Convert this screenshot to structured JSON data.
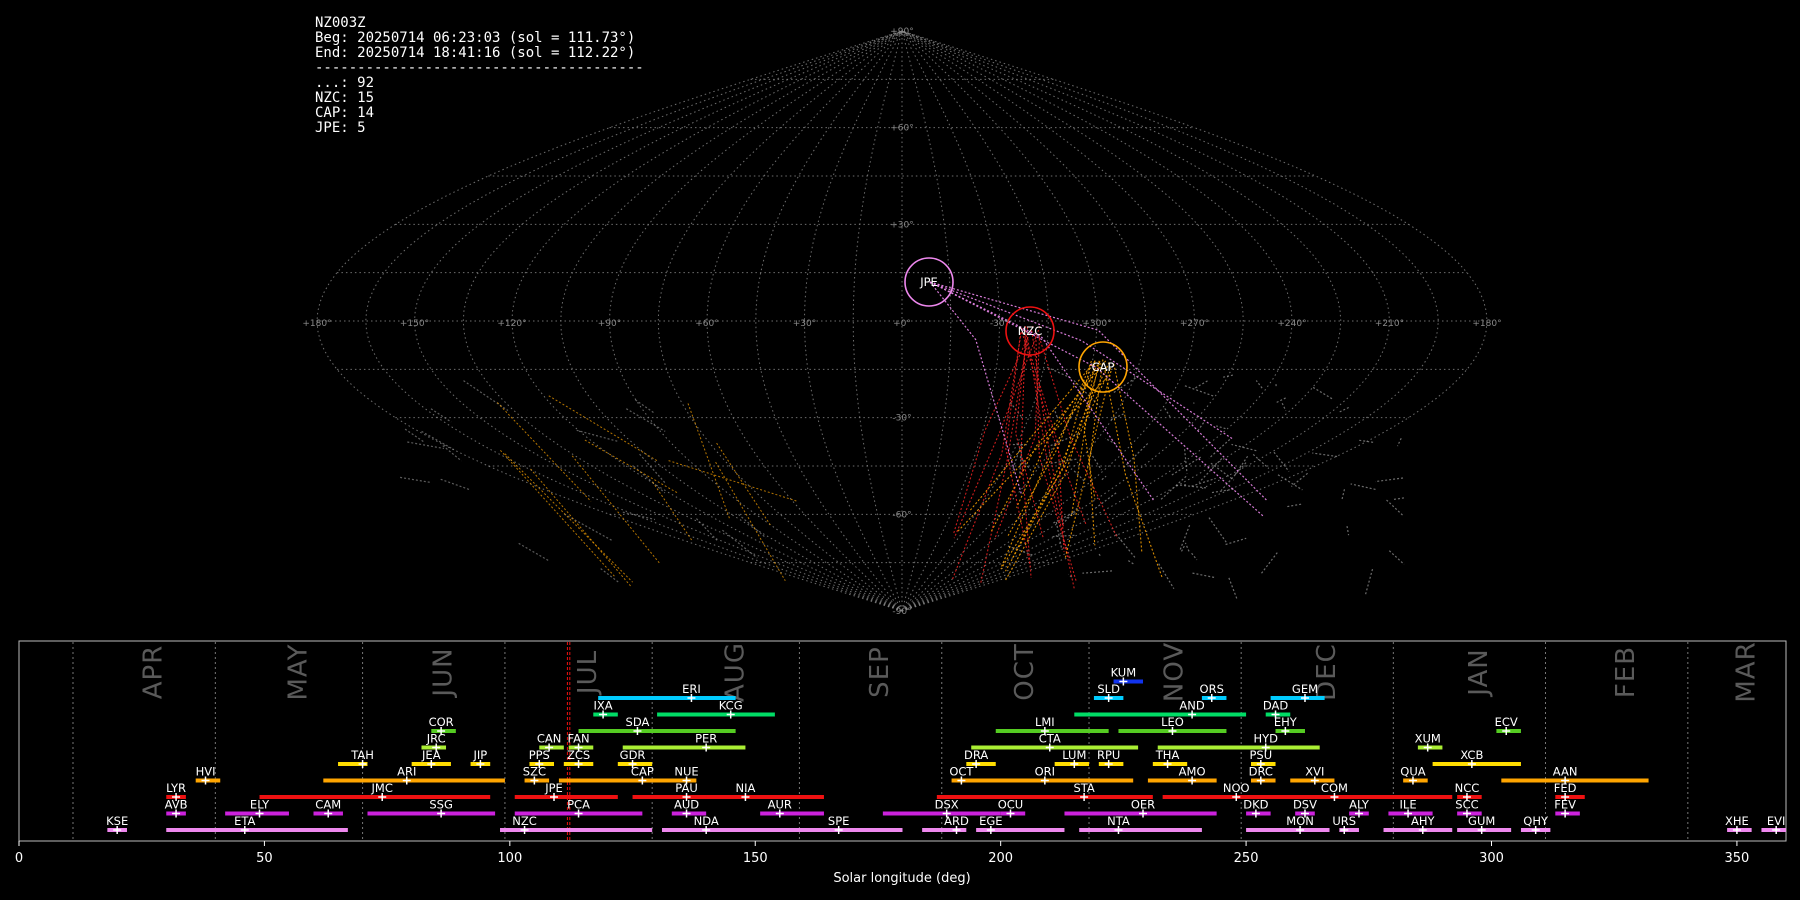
{
  "header": {
    "station": "NZ003Z",
    "begin": "Beg: 20250714 06:23:03 (sol = 111.73°)",
    "end": "End: 20250714 18:41:16 (sol = 112.22°)",
    "separator": "---------------------------------------",
    "counts": [
      "...: 92",
      "NZC: 15",
      "CAP: 14",
      "JPE: 5"
    ]
  },
  "sky_map": {
    "projection": "sinusoidal",
    "lon_ticks": [
      "+180°",
      "+150°",
      "+120°",
      "+90°",
      "+60°",
      "+30°",
      "+0°",
      "-30°",
      "+300°",
      "+270°",
      "+240°",
      "+210°",
      "+180°"
    ],
    "lat_ticks": [
      "+90°",
      "+60°",
      "+30°",
      "-30°",
      "-60°",
      "-90°"
    ],
    "radiants": [
      {
        "name": "JPE",
        "color": "#ee88ee"
      },
      {
        "name": "NZC",
        "color": "#ee1111"
      },
      {
        "name": "CAP",
        "color": "#ffa500"
      }
    ]
  },
  "chart_data": {
    "type": "timeline",
    "xlabel": "Solar longitude (deg)",
    "xlim": [
      0,
      360
    ],
    "xticks": [
      0,
      50,
      100,
      150,
      200,
      250,
      300,
      350
    ],
    "months": [
      {
        "name": "APR",
        "start": 11,
        "end": 40
      },
      {
        "name": "MAY",
        "start": 40,
        "end": 70
      },
      {
        "name": "JUN",
        "start": 70,
        "end": 99
      },
      {
        "name": "JUL",
        "start": 99,
        "end": 129
      },
      {
        "name": "AUG",
        "start": 129,
        "end": 159
      },
      {
        "name": "SEP",
        "start": 159,
        "end": 188
      },
      {
        "name": "OCT",
        "start": 188,
        "end": 218
      },
      {
        "name": "NOV",
        "start": 218,
        "end": 249
      },
      {
        "name": "DEC",
        "start": 249,
        "end": 280
      },
      {
        "name": "JAN",
        "start": 280,
        "end": 311
      },
      {
        "name": "FEB",
        "start": 311,
        "end": 340
      },
      {
        "name": "MAR",
        "start": 340,
        "end": 370
      }
    ],
    "current_sol": [
      111.73,
      112.22
    ],
    "showers": [
      {
        "code": "KUM",
        "start": 223,
        "end": 229,
        "peak": 225,
        "row": 9,
        "color": "#1133ee"
      },
      {
        "code": "ERI",
        "start": 118,
        "end": 146,
        "peak": 137,
        "row": 8,
        "color": "#00ccff"
      },
      {
        "code": "SLD",
        "start": 219,
        "end": 225,
        "peak": 222,
        "row": 8,
        "color": "#00ccff"
      },
      {
        "code": "ORS",
        "start": 241,
        "end": 246,
        "peak": 243,
        "row": 8,
        "color": "#00ccff"
      },
      {
        "code": "GEM",
        "start": 255,
        "end": 266,
        "peak": 262,
        "row": 8,
        "color": "#00ccff"
      },
      {
        "code": "IXA",
        "start": 117,
        "end": 122,
        "peak": 119,
        "row": 7,
        "color": "#00dd66"
      },
      {
        "code": "KCG",
        "start": 130,
        "end": 154,
        "peak": 145,
        "row": 7,
        "color": "#00dd66"
      },
      {
        "code": "AND",
        "start": 215,
        "end": 250,
        "peak": 239,
        "row": 7,
        "color": "#00dd66"
      },
      {
        "code": "DAD",
        "start": 254,
        "end": 259,
        "peak": 256,
        "row": 7,
        "color": "#00dd66"
      },
      {
        "code": "COR",
        "start": 84,
        "end": 89,
        "peak": 86,
        "row": 6,
        "color": "#55cc22"
      },
      {
        "code": "SDA",
        "start": 114,
        "end": 146,
        "peak": 126,
        "row": 6,
        "color": "#55cc22"
      },
      {
        "code": "LMI",
        "start": 199,
        "end": 222,
        "peak": 209,
        "row": 6,
        "color": "#55cc22"
      },
      {
        "code": "LEO",
        "start": 224,
        "end": 246,
        "peak": 235,
        "row": 6,
        "color": "#55cc22"
      },
      {
        "code": "EHY",
        "start": 256,
        "end": 262,
        "peak": 258,
        "row": 6,
        "color": "#55cc22"
      },
      {
        "code": "ECV",
        "start": 301,
        "end": 306,
        "peak": 303,
        "row": 6,
        "color": "#55cc22"
      },
      {
        "code": "JRC",
        "start": 82,
        "end": 87,
        "peak": 85,
        "row": 5,
        "color": "#aaee33"
      },
      {
        "code": "CAN",
        "start": 106,
        "end": 111,
        "peak": 108,
        "row": 5,
        "color": "#aaee33"
      },
      {
        "code": "FAN",
        "start": 112,
        "end": 117,
        "peak": 114,
        "row": 5,
        "color": "#aaee33"
      },
      {
        "code": "PER",
        "start": 123,
        "end": 148,
        "peak": 140,
        "row": 5,
        "color": "#aaee33"
      },
      {
        "code": "CTA",
        "start": 194,
        "end": 228,
        "peak": 210,
        "row": 5,
        "color": "#aaee33"
      },
      {
        "code": "HYD",
        "start": 232,
        "end": 265,
        "peak": 254,
        "row": 5,
        "color": "#aaee33"
      },
      {
        "code": "XUM",
        "start": 285,
        "end": 290,
        "peak": 287,
        "row": 5,
        "color": "#aaee33"
      },
      {
        "code": "TAH",
        "start": 65,
        "end": 71,
        "peak": 70,
        "row": 4,
        "color": "#ffdd00"
      },
      {
        "code": "JEA",
        "start": 80,
        "end": 88,
        "peak": 84,
        "row": 4,
        "color": "#ffdd00"
      },
      {
        "code": "JIP",
        "start": 92,
        "end": 96,
        "peak": 94,
        "row": 4,
        "color": "#ffdd00"
      },
      {
        "code": "PPS",
        "start": 104,
        "end": 109,
        "peak": 106,
        "row": 4,
        "color": "#ffdd00"
      },
      {
        "code": "ZCS",
        "start": 111,
        "end": 117,
        "peak": 114,
        "row": 4,
        "color": "#ffdd00"
      },
      {
        "code": "GDR",
        "start": 122,
        "end": 129,
        "peak": 125,
        "row": 4,
        "color": "#ffdd00"
      },
      {
        "code": "DRA",
        "start": 193,
        "end": 199,
        "peak": 195,
        "row": 4,
        "color": "#ffdd00"
      },
      {
        "code": "LUM",
        "start": 211,
        "end": 218,
        "peak": 215,
        "row": 4,
        "color": "#ffdd00"
      },
      {
        "code": "RPU",
        "start": 220,
        "end": 225,
        "peak": 222,
        "row": 4,
        "color": "#ffdd00"
      },
      {
        "code": "THA",
        "start": 231,
        "end": 238,
        "peak": 234,
        "row": 4,
        "color": "#ffdd00"
      },
      {
        "code": "PSU",
        "start": 251,
        "end": 256,
        "peak": 253,
        "row": 4,
        "color": "#ffdd00"
      },
      {
        "code": "XCB",
        "start": 288,
        "end": 306,
        "peak": 296,
        "row": 4,
        "color": "#ffdd00"
      },
      {
        "code": "HVI",
        "start": 36,
        "end": 41,
        "peak": 38,
        "row": 3,
        "color": "#ffa500"
      },
      {
        "code": "ARI",
        "start": 62,
        "end": 99,
        "peak": 79,
        "row": 3,
        "color": "#ffa500"
      },
      {
        "code": "SZC",
        "start": 103,
        "end": 108,
        "peak": 105,
        "row": 3,
        "color": "#ffa500"
      },
      {
        "code": "CAP",
        "start": 110,
        "end": 136,
        "peak": 127,
        "row": 3,
        "color": "#ffa500"
      },
      {
        "code": "NUE",
        "start": 134,
        "end": 138,
        "peak": 136,
        "row": 3,
        "color": "#ffa500"
      },
      {
        "code": "OCT",
        "start": 190,
        "end": 195,
        "peak": 192,
        "row": 3,
        "color": "#ffa500"
      },
      {
        "code": "ORI",
        "start": 193,
        "end": 227,
        "peak": 209,
        "row": 3,
        "color": "#ffa500"
      },
      {
        "code": "AMO",
        "start": 230,
        "end": 244,
        "peak": 239,
        "row": 3,
        "color": "#ffa500"
      },
      {
        "code": "DRC",
        "start": 251,
        "end": 256,
        "peak": 253,
        "row": 3,
        "color": "#ffa500"
      },
      {
        "code": "XVI",
        "start": 259,
        "end": 268,
        "peak": 264,
        "row": 3,
        "color": "#ffa500"
      },
      {
        "code": "QUA",
        "start": 282,
        "end": 287,
        "peak": 284,
        "row": 3,
        "color": "#ffa500"
      },
      {
        "code": "AAN",
        "start": 302,
        "end": 332,
        "peak": 315,
        "row": 3,
        "color": "#ffa500"
      },
      {
        "code": "LYR",
        "start": 30,
        "end": 34,
        "peak": 32,
        "row": 2,
        "color": "#ee1111"
      },
      {
        "code": "JMC",
        "start": 49,
        "end": 96,
        "peak": 74,
        "row": 2,
        "color": "#ee1111"
      },
      {
        "code": "JPE",
        "start": 101,
        "end": 122,
        "peak": 109,
        "row": 2,
        "color": "#ee1111"
      },
      {
        "code": "PAU",
        "start": 125,
        "end": 143,
        "peak": 136,
        "row": 2,
        "color": "#ee1111"
      },
      {
        "code": "NIA",
        "start": 140,
        "end": 164,
        "peak": 148,
        "row": 2,
        "color": "#ee1111"
      },
      {
        "code": "STA",
        "start": 187,
        "end": 231,
        "peak": 217,
        "row": 2,
        "color": "#ee1111"
      },
      {
        "code": "NOO",
        "start": 233,
        "end": 256,
        "peak": 248,
        "row": 2,
        "color": "#ee1111"
      },
      {
        "code": "COM",
        "start": 254,
        "end": 292,
        "peak": 268,
        "row": 2,
        "color": "#ee1111"
      },
      {
        "code": "NCC",
        "start": 293,
        "end": 298,
        "peak": 295,
        "row": 2,
        "color": "#ee1111"
      },
      {
        "code": "FED",
        "start": 313,
        "end": 319,
        "peak": 315,
        "row": 2,
        "color": "#ee1111"
      },
      {
        "code": "AVB",
        "start": 30,
        "end": 34,
        "peak": 32,
        "row": 1,
        "color": "#cc22dd"
      },
      {
        "code": "ELY",
        "start": 42,
        "end": 55,
        "peak": 49,
        "row": 1,
        "color": "#cc22dd"
      },
      {
        "code": "CAM",
        "start": 60,
        "end": 66,
        "peak": 63,
        "row": 1,
        "color": "#cc22dd"
      },
      {
        "code": "SSG",
        "start": 71,
        "end": 97,
        "peak": 86,
        "row": 1,
        "color": "#cc22dd"
      },
      {
        "code": "PCA",
        "start": 101,
        "end": 127,
        "peak": 114,
        "row": 1,
        "color": "#cc22dd"
      },
      {
        "code": "AUD",
        "start": 133,
        "end": 140,
        "peak": 136,
        "row": 1,
        "color": "#cc22dd"
      },
      {
        "code": "AUR",
        "start": 151,
        "end": 164,
        "peak": 155,
        "row": 1,
        "color": "#cc22dd"
      },
      {
        "code": "DSX",
        "start": 176,
        "end": 200,
        "peak": 189,
        "row": 1,
        "color": "#cc22dd"
      },
      {
        "code": "OCU",
        "start": 200,
        "end": 205,
        "peak": 202,
        "row": 1,
        "color": "#cc22dd"
      },
      {
        "code": "OER",
        "start": 213,
        "end": 244,
        "peak": 229,
        "row": 1,
        "color": "#cc22dd"
      },
      {
        "code": "DKD",
        "start": 250,
        "end": 255,
        "peak": 252,
        "row": 1,
        "color": "#cc22dd"
      },
      {
        "code": "DSV",
        "start": 260,
        "end": 264,
        "peak": 262,
        "row": 1,
        "color": "#cc22dd"
      },
      {
        "code": "ALY",
        "start": 271,
        "end": 275,
        "peak": 273,
        "row": 1,
        "color": "#cc22dd"
      },
      {
        "code": "ILE",
        "start": 279,
        "end": 288,
        "peak": 283,
        "row": 1,
        "color": "#cc22dd"
      },
      {
        "code": "SCC",
        "start": 293,
        "end": 298,
        "peak": 295,
        "row": 1,
        "color": "#cc22dd"
      },
      {
        "code": "FEV",
        "start": 313,
        "end": 318,
        "peak": 315,
        "row": 1,
        "color": "#cc22dd"
      },
      {
        "code": "KSE",
        "start": 18,
        "end": 22,
        "peak": 20,
        "row": 0,
        "color": "#ee88ee"
      },
      {
        "code": "ETA",
        "start": 30,
        "end": 67,
        "peak": 46,
        "row": 0,
        "color": "#ee88ee"
      },
      {
        "code": "NZC",
        "start": 98,
        "end": 129,
        "peak": 103,
        "row": 0,
        "color": "#ee88ee"
      },
      {
        "code": "NDA",
        "start": 131,
        "end": 163,
        "peak": 140,
        "row": 0,
        "color": "#ee88ee"
      },
      {
        "code": "SPE",
        "start": 161,
        "end": 180,
        "peak": 167,
        "row": 0,
        "color": "#ee88ee"
      },
      {
        "code": "ARD",
        "start": 184,
        "end": 193,
        "peak": 191,
        "row": 0,
        "color": "#ee88ee"
      },
      {
        "code": "EGE",
        "start": 195,
        "end": 213,
        "peak": 198,
        "row": 0,
        "color": "#ee88ee"
      },
      {
        "code": "NTA",
        "start": 216,
        "end": 241,
        "peak": 224,
        "row": 0,
        "color": "#ee88ee"
      },
      {
        "code": "MON",
        "start": 250,
        "end": 267,
        "peak": 261,
        "row": 0,
        "color": "#ee88ee"
      },
      {
        "code": "URS",
        "start": 269,
        "end": 273,
        "peak": 270,
        "row": 0,
        "color": "#ee88ee"
      },
      {
        "code": "AHY",
        "start": 278,
        "end": 292,
        "peak": 286,
        "row": 0,
        "color": "#ee88ee"
      },
      {
        "code": "GUM",
        "start": 293,
        "end": 304,
        "peak": 298,
        "row": 0,
        "color": "#ee88ee"
      },
      {
        "code": "QHY",
        "start": 306,
        "end": 312,
        "peak": 309,
        "row": 0,
        "color": "#ee88ee"
      },
      {
        "code": "XHE",
        "start": 348,
        "end": 353,
        "peak": 350,
        "row": 0,
        "color": "#ee88ee"
      },
      {
        "code": "EVI",
        "start": 355,
        "end": 360,
        "peak": 358,
        "row": 0,
        "color": "#ee88ee"
      }
    ]
  }
}
